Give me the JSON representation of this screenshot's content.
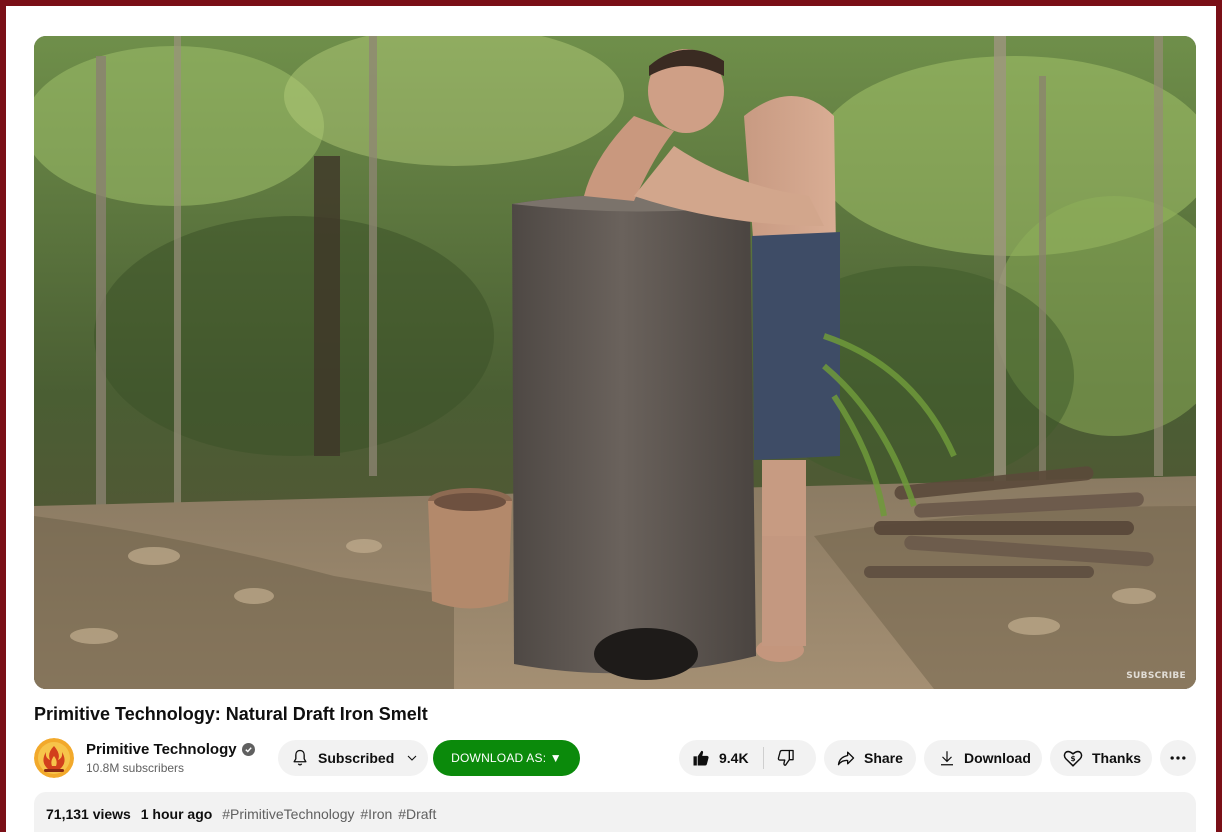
{
  "video": {
    "title": "Primitive Technology: Natural Draft Iron Smelt",
    "watermark": "SUBSCRIBE"
  },
  "channel": {
    "name": "Primitive Technology",
    "subscribers": "10.8M subscribers",
    "verified": true
  },
  "actions": {
    "subscribe_label": "Subscribed",
    "download_as_label": "DOWNLOAD AS: ▼",
    "like_count": "9.4K",
    "share_label": "Share",
    "download_label": "Download",
    "thanks_label": "Thanks"
  },
  "description": {
    "views": "71,131 views",
    "time": "1 hour ago",
    "hashtags": [
      "#PrimitiveTechnology",
      "#Iron",
      "#Draft"
    ]
  },
  "colors": {
    "frame_border": "#7a0f17",
    "download_as_bg": "#0b8a0b",
    "pill_bg": "#f2f2f2"
  },
  "icons": {
    "subscribe": "bell-icon",
    "subscribe_menu": "chevron-down-icon",
    "like": "thumbs-up-icon",
    "dislike": "thumbs-down-icon",
    "share": "share-arrow-icon",
    "download": "download-icon",
    "thanks": "heart-dollar-icon",
    "more": "more-horizontal-icon",
    "verified": "verified-check-icon",
    "avatar": "fire-logo-icon"
  }
}
